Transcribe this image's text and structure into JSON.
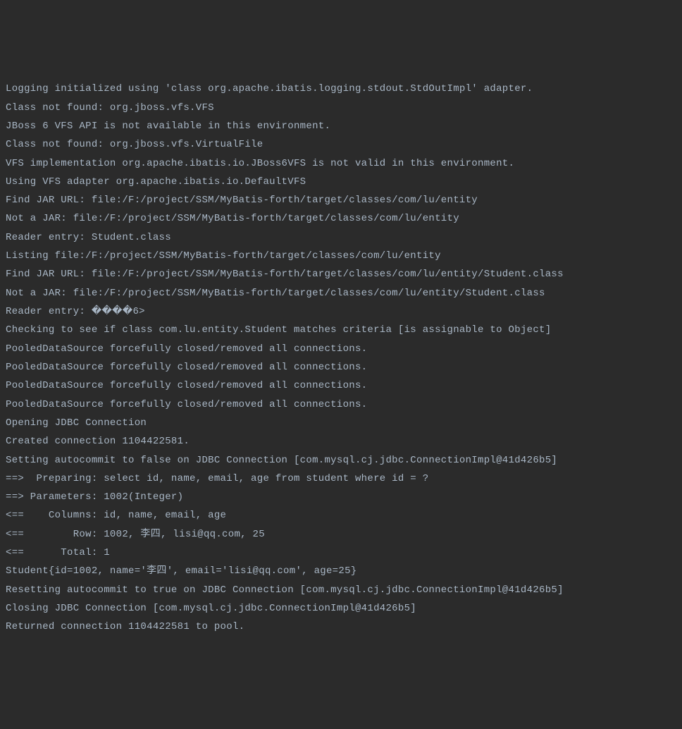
{
  "log_lines": [
    "Logging initialized using 'class org.apache.ibatis.logging.stdout.StdOutImpl' adapter.",
    "Class not found: org.jboss.vfs.VFS",
    "JBoss 6 VFS API is not available in this environment.",
    "Class not found: org.jboss.vfs.VirtualFile",
    "VFS implementation org.apache.ibatis.io.JBoss6VFS is not valid in this environment.",
    "Using VFS adapter org.apache.ibatis.io.DefaultVFS",
    "Find JAR URL: file:/F:/project/SSM/MyBatis-forth/target/classes/com/lu/entity",
    "Not a JAR: file:/F:/project/SSM/MyBatis-forth/target/classes/com/lu/entity",
    "Reader entry: Student.class",
    "Listing file:/F:/project/SSM/MyBatis-forth/target/classes/com/lu/entity",
    "Find JAR URL: file:/F:/project/SSM/MyBatis-forth/target/classes/com/lu/entity/Student.class",
    "Not a JAR: file:/F:/project/SSM/MyBatis-forth/target/classes/com/lu/entity/Student.class",
    "Reader entry: ����6>",
    "Checking to see if class com.lu.entity.Student matches criteria [is assignable to Object]",
    "PooledDataSource forcefully closed/removed all connections.",
    "PooledDataSource forcefully closed/removed all connections.",
    "PooledDataSource forcefully closed/removed all connections.",
    "PooledDataSource forcefully closed/removed all connections.",
    "Opening JDBC Connection",
    "Created connection 1104422581.",
    "Setting autocommit to false on JDBC Connection [com.mysql.cj.jdbc.ConnectionImpl@41d426b5]",
    "==>  Preparing: select id, name, email, age from student where id = ?",
    "==> Parameters: 1002(Integer)",
    "<==    Columns: id, name, email, age",
    "<==        Row: 1002, 李四, lisi@qq.com, 25",
    "<==      Total: 1",
    "Student{id=1002, name='李四', email='lisi@qq.com', age=25}",
    "Resetting autocommit to true on JDBC Connection [com.mysql.cj.jdbc.ConnectionImpl@41d426b5]",
    "Closing JDBC Connection [com.mysql.cj.jdbc.ConnectionImpl@41d426b5]",
    "Returned connection 1104422581 to pool."
  ]
}
